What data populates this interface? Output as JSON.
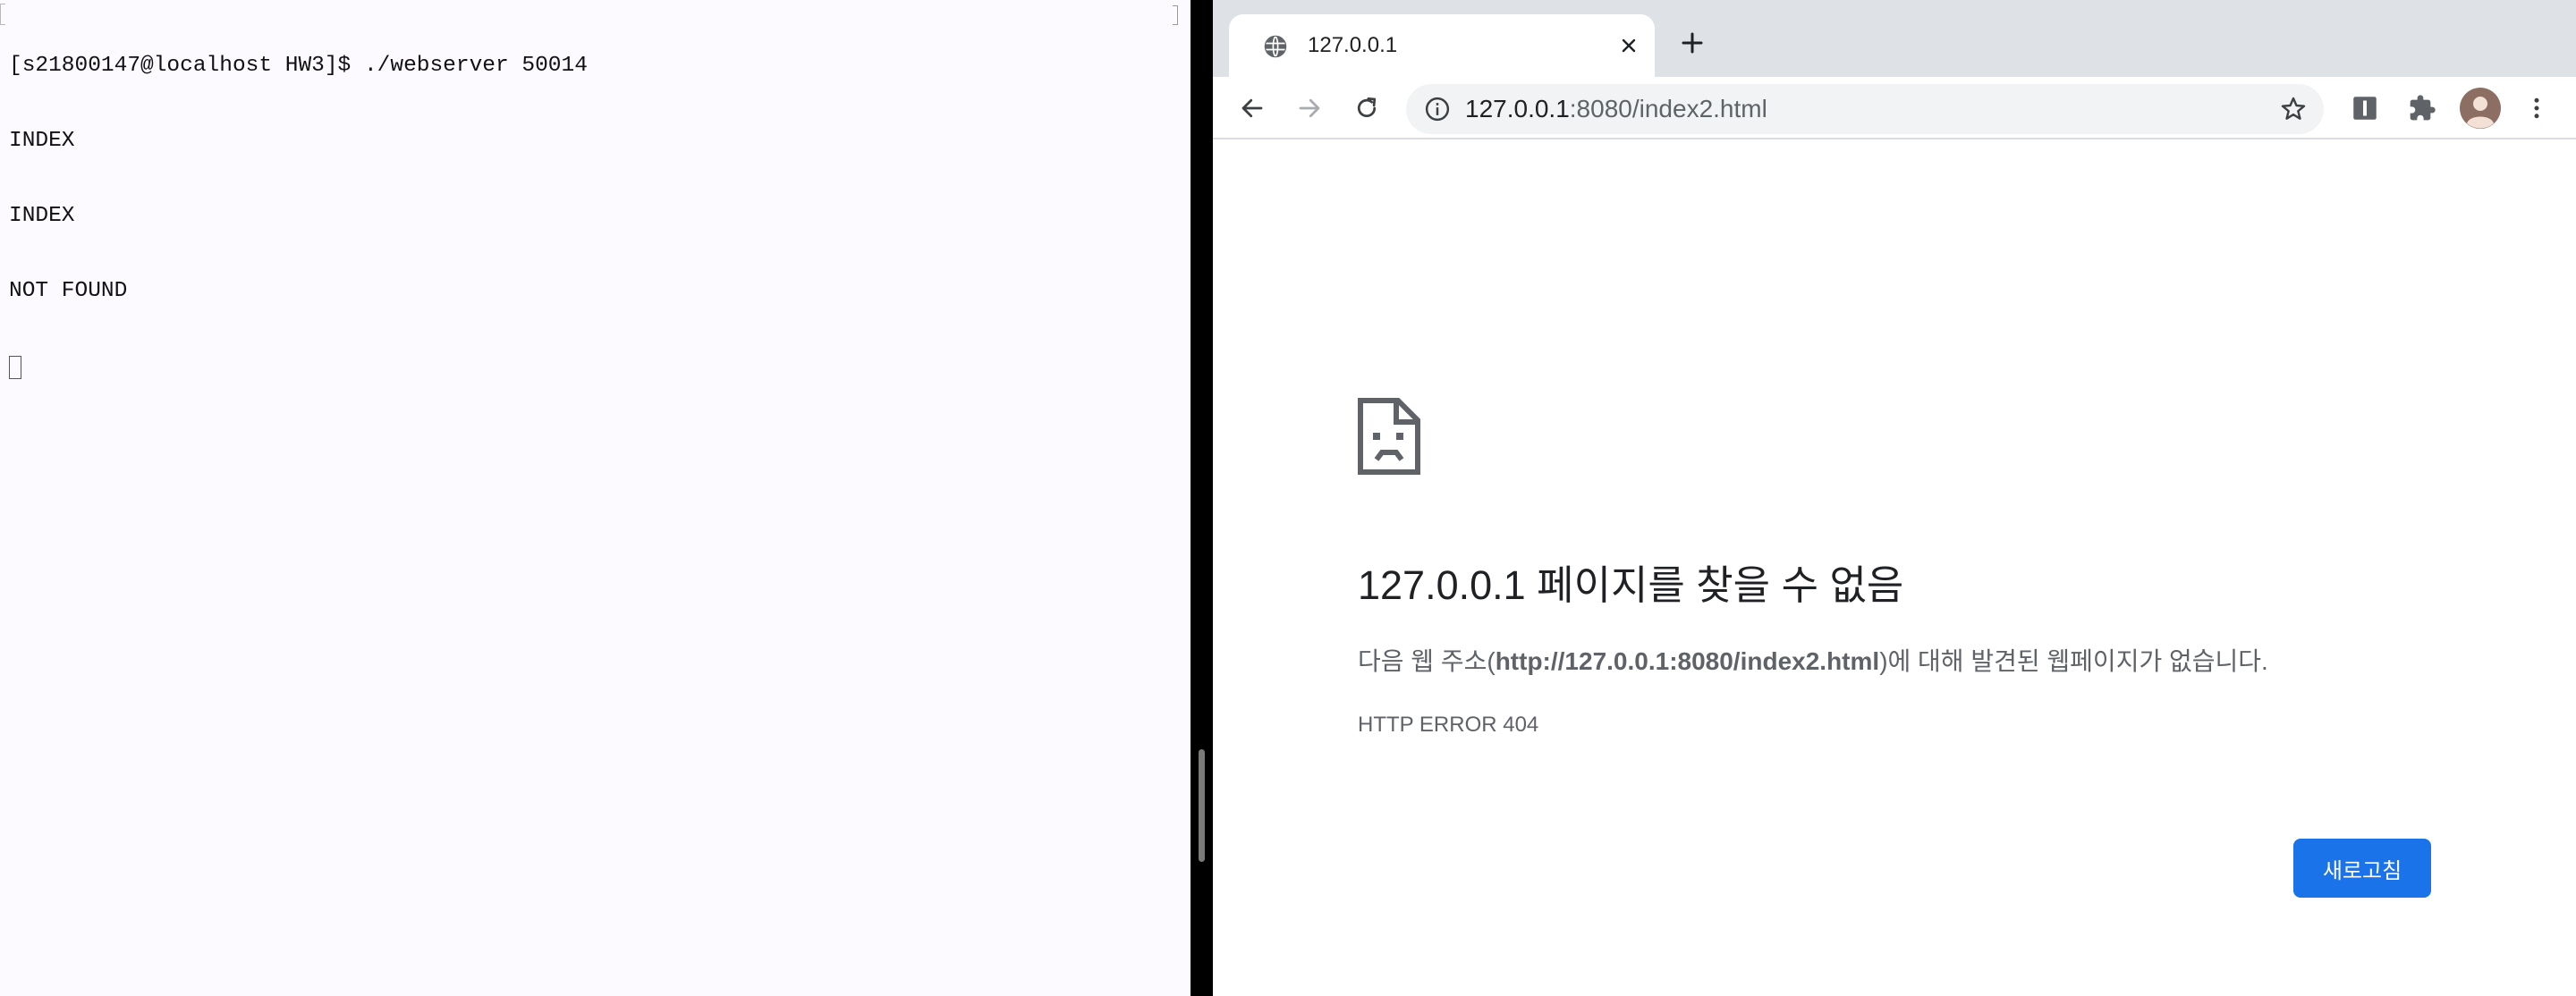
{
  "terminal": {
    "lines": [
      "[s21800147@localhost HW3]$ ./webserver 50014",
      "INDEX",
      "INDEX",
      "NOT FOUND"
    ]
  },
  "browser": {
    "tab": {
      "title": "127.0.0.1",
      "favicon": "globe-icon"
    },
    "toolbar": {
      "back": "arrow-left-icon",
      "forward": "arrow-right-icon",
      "reload": "reload-icon",
      "url_host": "127.0.0.1",
      "url_rest": ":8080/index2.html",
      "bookmark": "star-icon",
      "extensions": [
        "reader-icon",
        "puzzle-icon"
      ],
      "profile": "avatar",
      "menu": "kebab-menu-icon"
    },
    "error_page": {
      "icon": "sad-document-icon",
      "title": "127.0.0.1 페이지를 찾을 수 없음",
      "desc_prefix": "다음 웹 주소(",
      "desc_url": "http://127.0.0.1:8080/index2.html",
      "desc_suffix": ")에 대해 발견된 웹페이지가 없습니다.",
      "error_code": "HTTP ERROR 404",
      "reload_label": "새로고침"
    }
  },
  "colors": {
    "terminal_bg": "#fcfaff",
    "tab_strip": "#dee1e6",
    "omnibox": "#f1f3f4",
    "accent_blue": "#1a73e8",
    "secondary_text": "#5f6368"
  }
}
